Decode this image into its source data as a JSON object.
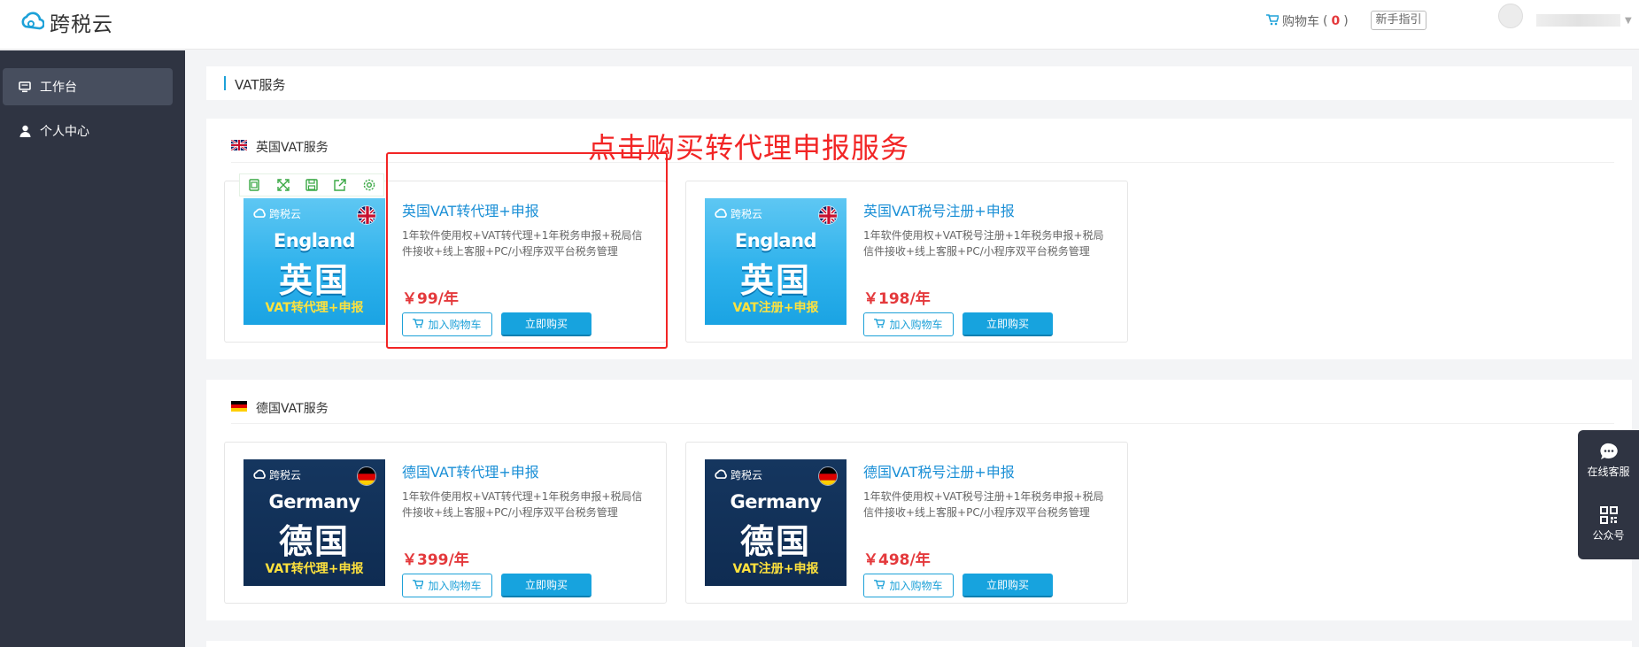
{
  "header": {
    "logo_text": "跨税云",
    "cart_label": "购物车",
    "cart_count_open": "(",
    "cart_count": "0",
    "cart_count_close": ")",
    "guide_label": "新手指引"
  },
  "sidebar": {
    "items": [
      {
        "label": "工作台",
        "icon": "monitor-icon",
        "active": true
      },
      {
        "label": "个人中心",
        "icon": "user-icon",
        "active": false
      }
    ]
  },
  "page": {
    "title": "VAT服务"
  },
  "annotation": {
    "text": "点击购买转代理申报服务"
  },
  "sections": [
    {
      "title": "英国VAT服务",
      "flag": "uk-flag-icon",
      "cards": [
        {
          "title": "英国VAT转代理+申报",
          "desc": "1年软件使用权+VAT转代理+1年税务申报+税局信件接收+线上客服+PC/小程序双平台税务管理",
          "price": "￥99/年",
          "banner_country": "England",
          "banner_cn": "英国",
          "banner_service": "VAT转代理+申报"
        },
        {
          "title": "英国VAT税号注册+申报",
          "desc": "1年软件使用权+VAT税号注册+1年税务申报+税局信件接收+线上客服+PC/小程序双平台税务管理",
          "price": "￥198/年",
          "banner_country": "England",
          "banner_cn": "英国",
          "banner_service": "VAT注册+申报"
        }
      ]
    },
    {
      "title": "德国VAT服务",
      "flag": "de-flag-icon",
      "cards": [
        {
          "title": "德国VAT转代理+申报",
          "desc": "1年软件使用权+VAT转代理+1年税务申报+税局信件接收+线上客服+PC/小程序双平台税务管理",
          "price": "￥399/年",
          "banner_country": "Germany",
          "banner_cn": "德国",
          "banner_service": "VAT转代理+申报"
        },
        {
          "title": "德国VAT税号注册+申报",
          "desc": "1年软件使用权+VAT税号注册+1年税务申报+税局信件接收+线上客服+PC/小程序双平台税务管理",
          "price": "￥498/年",
          "banner_country": "Germany",
          "banner_cn": "德国",
          "banner_service": "VAT注册+申报"
        }
      ]
    }
  ],
  "buttons": {
    "add_cart": "加入购物车",
    "buy_now": "立即购买"
  },
  "banner_logo": "跨税云",
  "float_panel": {
    "chat_label": "在线客服",
    "qr_label": "公众号"
  },
  "colors": {
    "accent": "#1da1d8",
    "price": "#e4393c",
    "annotation": "#f22525",
    "sidebar": "#2f3442"
  }
}
